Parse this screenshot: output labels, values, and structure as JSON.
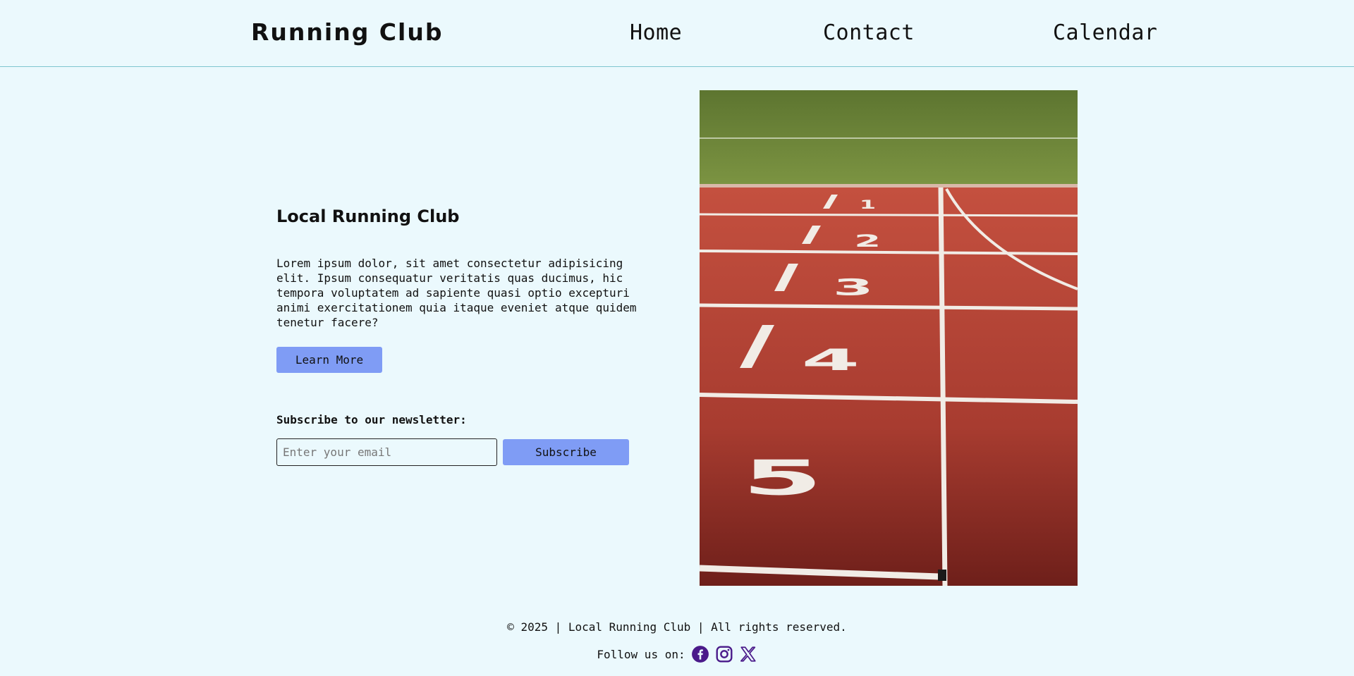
{
  "header": {
    "brand": "Running Club",
    "nav": {
      "home": "Home",
      "contact": "Contact",
      "calendar": "Calendar"
    }
  },
  "hero": {
    "title": "Local Running Club",
    "text": "Lorem ipsum dolor, sit amet consectetur adipisicing elit. Ipsum consequatur veritatis quas ducimus, hic tempora voluptatem ad sapiente quasi optio excepturi animi exercitationem quia itaque eveniet atque quidem tenetur facere?",
    "learn_more": "Learn More",
    "image_icon": "running-track-photo"
  },
  "newsletter": {
    "label": "Subscribe to our newsletter:",
    "email_placeholder": "Enter your email",
    "email_value": "",
    "subscribe": "Subscribe"
  },
  "footer": {
    "copyright": "© 2025 | Local Running Club | All rights reserved.",
    "follow": "Follow us on:",
    "social_icons": [
      "facebook-icon",
      "instagram-icon",
      "x-icon"
    ],
    "social_color": "#4a1a8a"
  },
  "colors": {
    "background": "#ebf9fd",
    "button": "#7f9cf5",
    "header_border": "#7fc6d0",
    "track": "#b4463a",
    "grass": "#6f8a3a"
  }
}
